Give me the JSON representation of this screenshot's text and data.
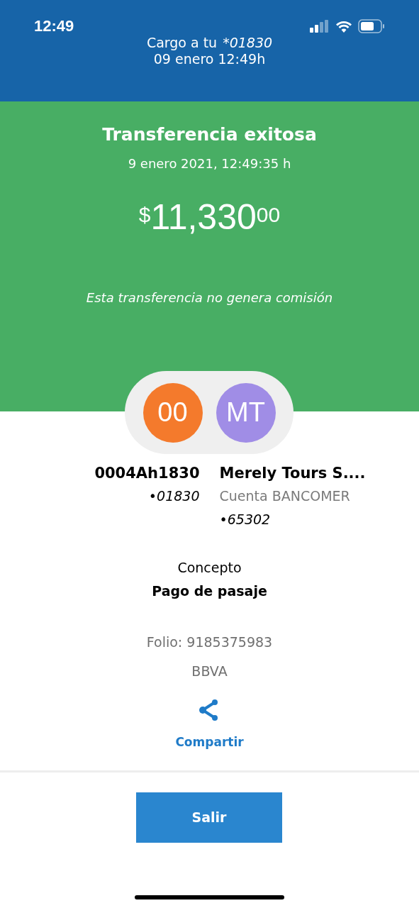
{
  "status_bar": {
    "time": "12:49"
  },
  "header": {
    "charge_label": "Cargo a tu",
    "charge_account": "*01830",
    "date": "09 enero 12:49h"
  },
  "result": {
    "title": "Transferencia exitosa",
    "datetime": "9 enero 2021, 12:49:35 h",
    "amount": {
      "currency": "$",
      "whole": "11,330",
      "cents": "00"
    },
    "note": "Esta transferencia no genera comisión"
  },
  "parties": [
    {
      "initials": "00",
      "color": "#f47a2c",
      "name": "0004Ah1830",
      "account": "•01830"
    },
    {
      "initials": "MT",
      "color": "#a08de6",
      "name": "Merely Tours S....",
      "bank": "Cuenta BANCOMER",
      "account": "•65302"
    }
  ],
  "concept": {
    "label": "Concepto",
    "value": "Pago de pasaje"
  },
  "folio": "Folio: 9185375983",
  "bank": "BBVA",
  "share": {
    "label": "Compartir"
  },
  "exit_button": "Salir"
}
